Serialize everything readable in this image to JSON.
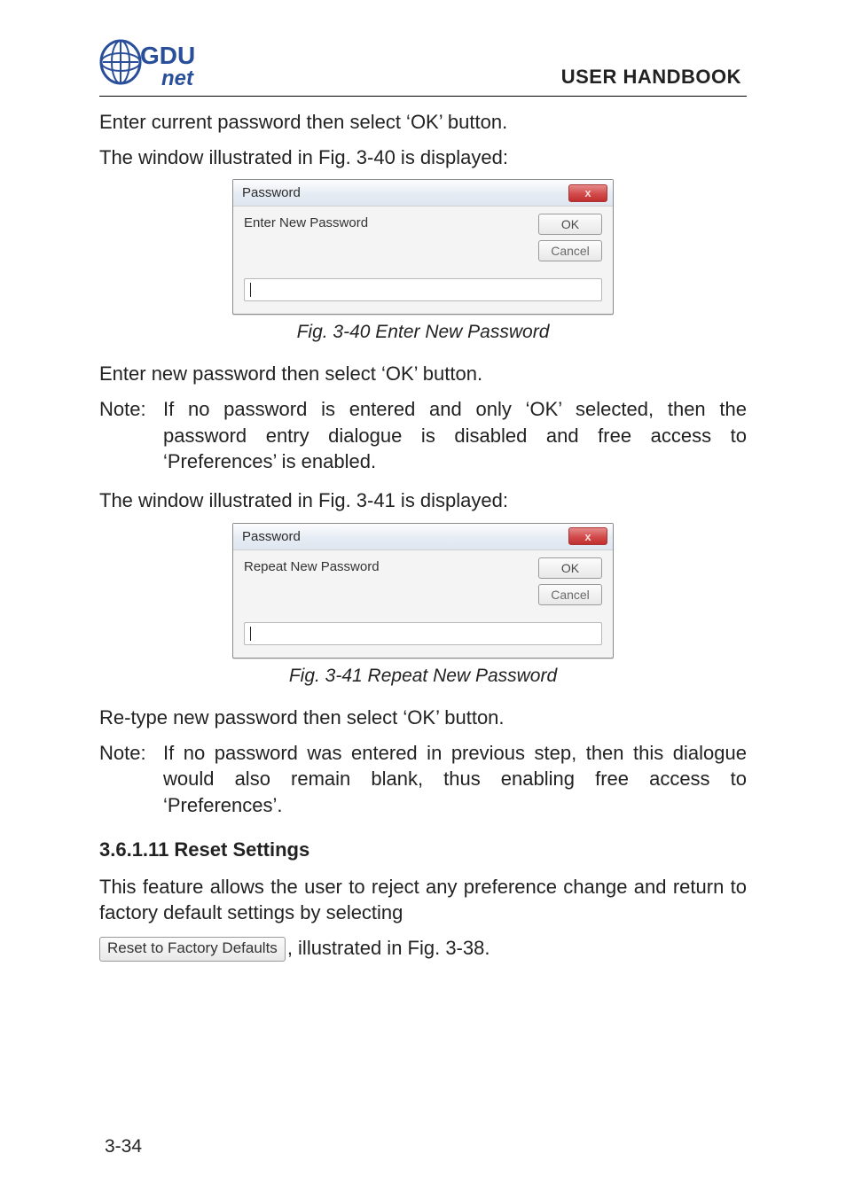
{
  "logo": {
    "brand_top": "GDU",
    "brand_bottom": "net"
  },
  "header": {
    "title": "USER HANDBOOK"
  },
  "para1": "Enter current password then select ‘OK’ button.",
  "para2": "The window illustrated in Fig. 3-40 is displayed:",
  "fig1": {
    "dialog_title": "Password",
    "label": "Enter New Password",
    "ok": "OK",
    "cancel": "Cancel",
    "close_glyph": "x",
    "caption": "Fig. 3-40  Enter New Password"
  },
  "para3": "Enter new password then select ‘OK’ button.",
  "note1": {
    "label": "Note:",
    "body": "If no password is entered and only ‘OK’ selected, then the password entry dialogue is disabled and free access to ‘Preferences’ is enabled."
  },
  "para4": "The window illustrated in Fig. 3-41 is displayed:",
  "fig2": {
    "dialog_title": "Password",
    "label": "Repeat New Password",
    "ok": "OK",
    "cancel": "Cancel",
    "close_glyph": "x",
    "caption": "Fig. 3-41  Repeat New Password"
  },
  "para5": "Re-type new password then select ‘OK’ button.",
  "note2": {
    "label": "Note:",
    "body": "If no password was entered in previous step, then this dialogue would also remain blank, thus enabling free access to ‘Preferences’."
  },
  "section": {
    "heading": "3.6.1.11  Reset Settings"
  },
  "para6a": "This feature allows the user to reject any preference change and return to factory default settings by selecting ",
  "reset_button_label": "Reset to Factory Defaults",
  "para6b": ", illustrated in Fig. 3-38.",
  "page_number": "3-34"
}
